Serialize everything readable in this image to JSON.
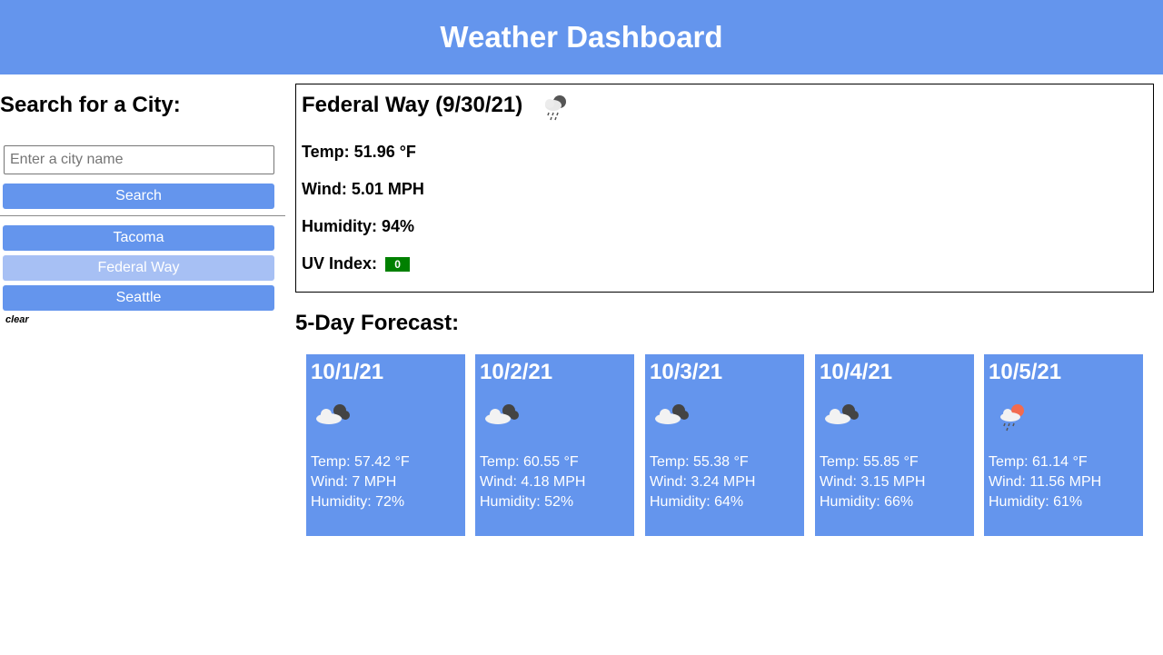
{
  "header": {
    "title": "Weather Dashboard"
  },
  "search": {
    "heading": "Search for a City:",
    "placeholder": "Enter a city name",
    "value": "",
    "button_label": "Search"
  },
  "history": {
    "items": [
      {
        "label": "Tacoma",
        "active": false
      },
      {
        "label": "Federal Way",
        "active": true
      },
      {
        "label": "Seattle",
        "active": false
      }
    ],
    "clear_label": "clear"
  },
  "current": {
    "title": "Federal Way (9/30/21)",
    "icon": "rain-cloud-icon",
    "temp": "Temp: 51.96 °F",
    "wind": "Wind: 5.01 MPH",
    "humidity": "Humidity: 94%",
    "uv_label": "UV Index:",
    "uv_value": "0",
    "uv_color": "#008000"
  },
  "forecast": {
    "heading": "5-Day Forecast:",
    "days": [
      {
        "date": "10/1/21",
        "icon": "broken-clouds-icon",
        "temp": "Temp: 57.42 °F",
        "wind": "Wind: 7 MPH",
        "humidity": "Humidity: 72%"
      },
      {
        "date": "10/2/21",
        "icon": "broken-clouds-icon",
        "temp": "Temp: 60.55 °F",
        "wind": "Wind: 4.18 MPH",
        "humidity": "Humidity: 52%"
      },
      {
        "date": "10/3/21",
        "icon": "broken-clouds-icon",
        "temp": "Temp: 55.38 °F",
        "wind": "Wind: 3.24 MPH",
        "humidity": "Humidity: 64%"
      },
      {
        "date": "10/4/21",
        "icon": "broken-clouds-icon",
        "temp": "Temp: 55.85 °F",
        "wind": "Wind: 3.15 MPH",
        "humidity": "Humidity: 66%"
      },
      {
        "date": "10/5/21",
        "icon": "sun-rain-icon",
        "temp": "Temp: 61.14 °F",
        "wind": "Wind: 11.56 MPH",
        "humidity": "Humidity: 61%"
      }
    ]
  },
  "colors": {
    "accent": "#6495ed",
    "accent_active": "#a7c0f4",
    "uv_low": "#008000"
  }
}
